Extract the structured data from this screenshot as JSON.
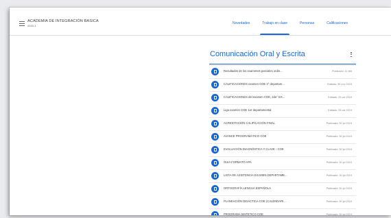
{
  "header": {
    "class_name": "ACADEMIA DE INTEGRACIÓN BASICA",
    "class_section": "2020-1",
    "tabs": [
      {
        "label": "Novedades",
        "active": false
      },
      {
        "label": "Trabajo en clase",
        "active": true
      },
      {
        "label": "Personas",
        "active": false
      },
      {
        "label": "Calificaciones",
        "active": false
      }
    ]
  },
  "topic": {
    "title": "Comunicación Oral y Escrita",
    "items": [
      {
        "title": "Resultados de los examenes parciales ordin...",
        "date": "Publicado: 11 feb",
        "icon": "assignment-icon"
      },
      {
        "title": "CALIFICACIONES examen COE 3° departam...",
        "date": "Editado: 30 nov 2019",
        "icon": "assignment-icon"
      },
      {
        "title": "CALIFICACIONES del examen COE, 2do° EX...",
        "date": "Editado: 29 oct 2019",
        "icon": "assignment-icon"
      },
      {
        "title": "Liga examen COE 1er departamental",
        "date": "Editado: 25 oct 2019",
        "icon": "assignment-icon"
      },
      {
        "title": "ACREDITACIÓN CALIFICACIÓN FINAL",
        "date": "Publicado: 30 jul 2019",
        "icon": "assignment-icon"
      },
      {
        "title": "AVANCE PROGRAMÁTICO COE",
        "date": "Publicado: 30 jul 2019",
        "icon": "assignment-icon"
      },
      {
        "title": "EVALUACIÓN DIAGNÓSTICA Y CLAVE - COE",
        "date": "Publicado: 30 jul 2019",
        "icon": "assignment-icon"
      },
      {
        "title": "GUIA FORMATO APA",
        "date": "Publicado: 30 jul 2019",
        "icon": "assignment-icon"
      },
      {
        "title": "LISTA DE ASISTENCIA EXAMEN DEPARTAME...",
        "date": "Publicado: 30 jul 2019",
        "icon": "assignment-icon"
      },
      {
        "title": "ORTOGRAFÍA LENGUA ESPAÑOLA",
        "date": "Publicado: 30 jul 2019",
        "icon": "assignment-icon"
      },
      {
        "title": "PLANEACIÓN DIDÁCTICA COE (CALENDARI...",
        "date": "Publicado: 30 jul 2019",
        "icon": "assignment-icon"
      },
      {
        "title": "PROGRAMA SINTETICO COE",
        "date": "Publicado: 30 jul 2019",
        "icon": "assignment-icon"
      }
    ]
  },
  "colors": {
    "accent": "#1967d2",
    "text": "#3c4043",
    "muted": "#80868b"
  }
}
